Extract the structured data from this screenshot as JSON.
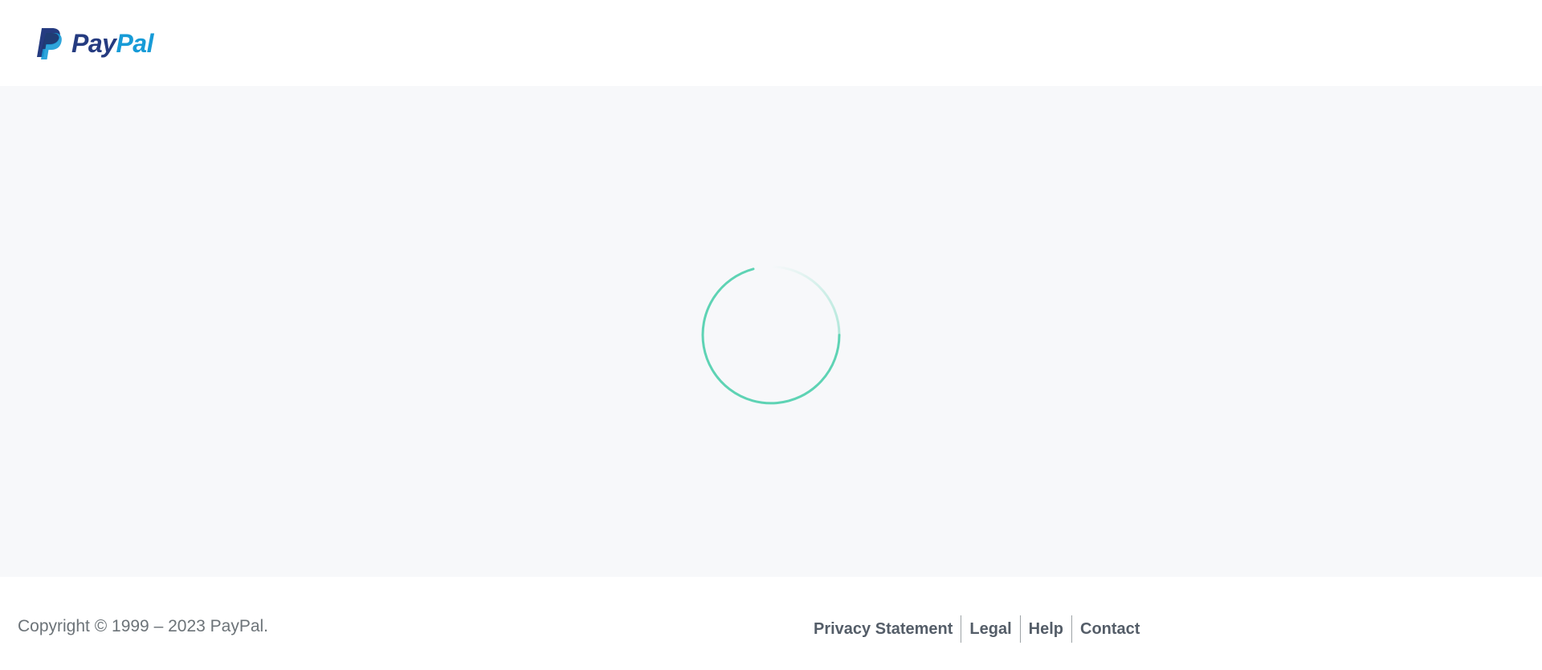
{
  "header": {
    "logo": {
      "icon": "paypal-logo-icon",
      "text_pay": "Pay",
      "text_pal": "Pal",
      "colors": {
        "pay": "#253b80",
        "pal": "#179bd7"
      }
    }
  },
  "main": {
    "background": "#f7f8fa",
    "spinner": {
      "icon": "loading-spinner-icon",
      "color": "#5ed3b4"
    }
  },
  "footer": {
    "copyright": "Copyright © 1999 – 2023 PayPal.",
    "links": [
      {
        "label": "Privacy Statement"
      },
      {
        "label": "Legal"
      },
      {
        "label": "Help"
      },
      {
        "label": "Contact"
      }
    ]
  }
}
